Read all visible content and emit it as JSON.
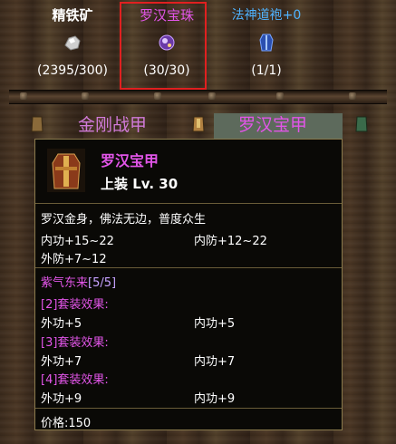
{
  "materials": [
    {
      "name": "精铁矿",
      "count": "(2395/300)",
      "icon": "ore-icon"
    },
    {
      "name": "罗汉宝珠",
      "count": "(30/30)",
      "icon": "orb-icon"
    },
    {
      "name": "法神道袍+0",
      "count": "(1/1)",
      "icon": "robe-icon"
    }
  ],
  "tabs": [
    {
      "label": "金刚战甲"
    },
    {
      "label": "罗汉宝甲"
    }
  ],
  "tooltip": {
    "title": "罗汉宝甲",
    "level": "上装 Lv. 30",
    "description": "罗汉金身，佛法无边，普度众生",
    "stats": [
      {
        "left": "内功+15~22",
        "right": "内防+12~22"
      },
      {
        "left": "外防+7~12",
        "right": ""
      }
    ],
    "set_name": "紫气东来",
    "set_progress": "[5/5]",
    "set_bonuses": [
      {
        "title": "[2]套装效果:",
        "left": "外功+5",
        "right": "内功+5"
      },
      {
        "title": "[3]套装效果:",
        "left": "外功+7",
        "right": "内功+7"
      },
      {
        "title": "[4]套装效果:",
        "left": "外功+9",
        "right": "内功+9"
      }
    ],
    "price": "价格:150"
  }
}
